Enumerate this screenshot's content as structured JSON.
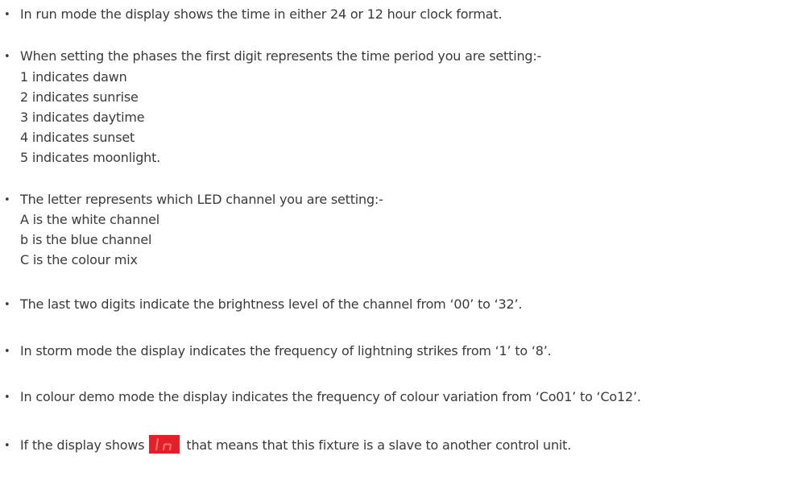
{
  "bullets": {
    "run_mode": "In run mode the display shows the time in either 24 or 12 hour clock format.",
    "phases_intro": "When setting the phases the first digit represents the time period you are setting:-",
    "phases": [
      "1 indicates dawn",
      "2 indicates sunrise",
      "3 indicates daytime",
      "4 indicates sunset",
      "5 indicates moonlight."
    ],
    "letter_intro": "The letter represents which LED channel you are setting:-",
    "letters": [
      "A is the white channel",
      "b is the blue channel",
      "C is the colour mix"
    ],
    "brightness": "The last two digits indicate the brightness level of the channel from ‘00’ to ‘32’.",
    "storm": "In storm mode the display indicates the frequency of lightning strikes from ‘1’ to ‘8’.",
    "colour_demo": "In colour demo mode the display indicates the frequency of colour variation from ‘Co01’ to ‘Co12’.",
    "slave_before": "If the display shows",
    "slave_after": "that means that this fixture is a slave to another control unit."
  },
  "bullet_glyph": "•",
  "display_icon": {
    "name": "ln-led-display-icon",
    "text": "ln",
    "background": "#e3202a",
    "segment_color": "#ff6a6a"
  }
}
